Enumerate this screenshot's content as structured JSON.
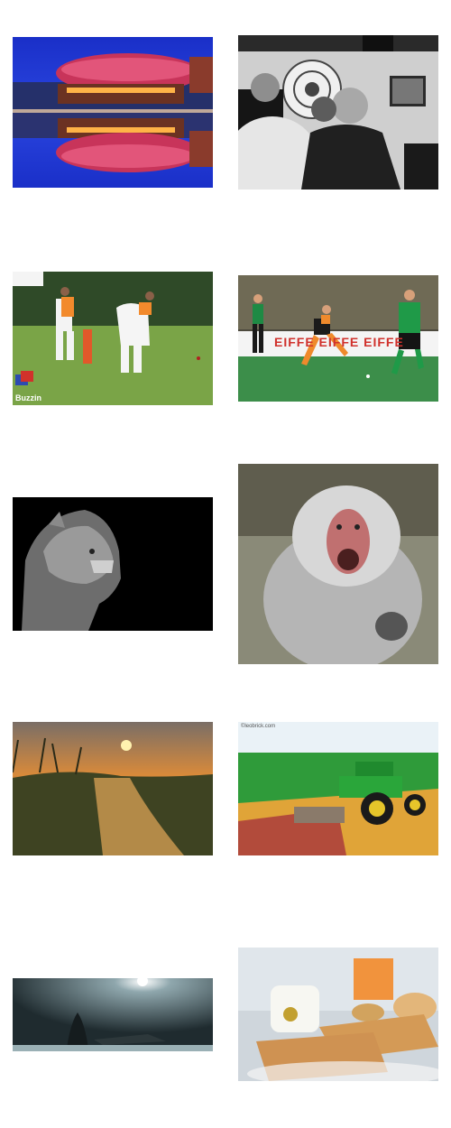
{
  "gallery": {
    "items": [
      {
        "id": "stadium",
        "subject": "Stadium at night reflected in water"
      },
      {
        "id": "men",
        "subject": "Men in black and white"
      },
      {
        "id": "cricket",
        "subject": "Cricket match"
      },
      {
        "id": "hockey",
        "subject": "Field hockey players",
        "banner": "EIFFE EIFFE EIFFE"
      },
      {
        "id": "lioness",
        "subject": "Lioness on black background"
      },
      {
        "id": "baboon",
        "subject": "Baboon with open mouth"
      },
      {
        "id": "sunset",
        "subject": "Sunset over canal and reeds"
      },
      {
        "id": "lego",
        "subject": "Lego tractor",
        "watermark": "©leobrick.com"
      },
      {
        "id": "misty",
        "subject": "Misty night scene"
      },
      {
        "id": "breakfast",
        "subject": "Breakfast with toast and coffee"
      }
    ],
    "cricket_watermark": "Buzzin"
  },
  "colors": {
    "background": "#ffffff",
    "stadium_sky": "#1a3bd6",
    "hockey_green": "#2e8a3a",
    "sunset_orange": "#d98a3a",
    "lego_green": "#2f9b3a"
  }
}
